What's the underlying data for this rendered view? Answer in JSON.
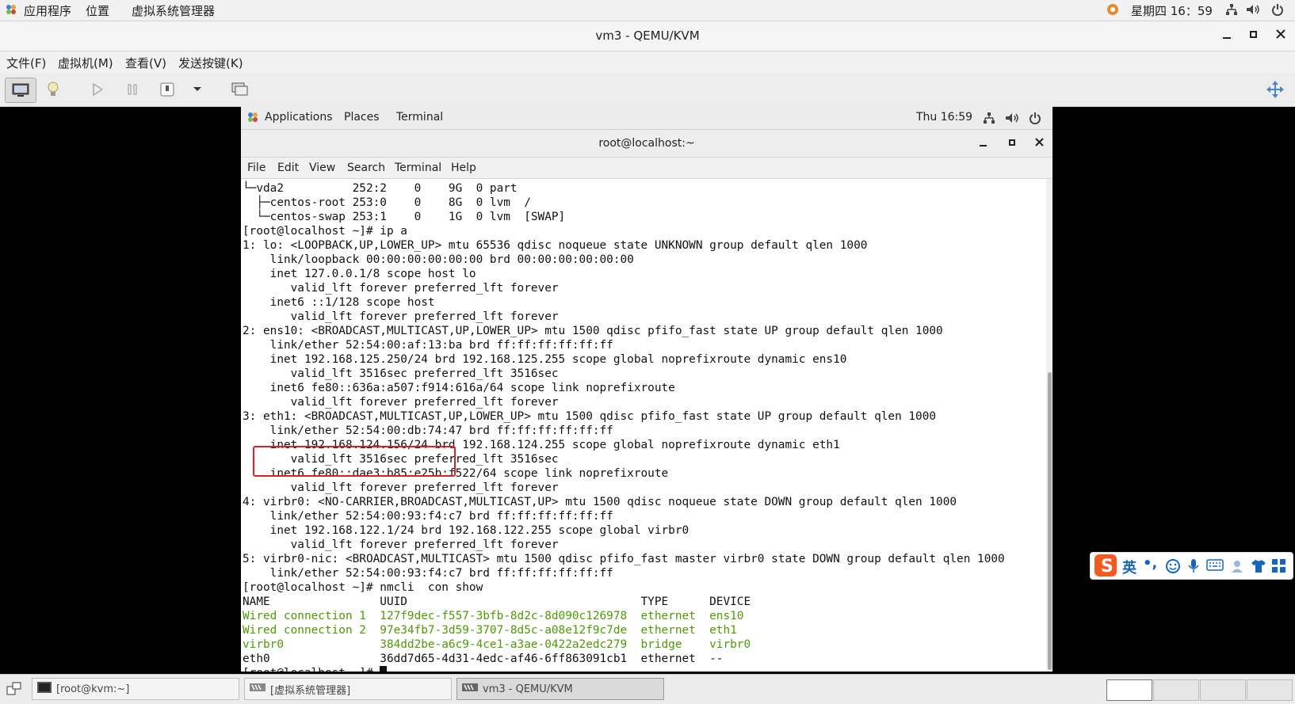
{
  "host_panel": {
    "applications": "应用程序",
    "places": "位置",
    "virt_manager": "虚拟系统管理器",
    "clock": "星期四 16：59"
  },
  "qemu_window": {
    "title": "vm3 - QEMU/KVM",
    "menu": [
      "文件(F)",
      "虚拟机(M)",
      "查看(V)",
      "发送按键(K)"
    ],
    "icons": [
      "monitor-icon",
      "lightbulb-icon",
      "play-icon",
      "pause-icon",
      "power-icon",
      "dropdown-icon",
      "screens-icon",
      "fullscreen-icon"
    ]
  },
  "guest_panel": {
    "applications": "Applications",
    "places": "Places",
    "terminal": "Terminal",
    "clock": "Thu 16:59"
  },
  "terminal_window": {
    "title": "root@localhost:~",
    "menu": [
      "File",
      "Edit",
      "View",
      "Search",
      "Terminal",
      "Help"
    ],
    "lines": [
      "└─vda2          252:2    0    9G  0 part",
      "  ├─centos-root 253:0    0    8G  0 lvm  /",
      "  └─centos-swap 253:1    0    1G  0 lvm  [SWAP]",
      "[root@localhost ~]# ip a",
      "1: lo: <LOOPBACK,UP,LOWER_UP> mtu 65536 qdisc noqueue state UNKNOWN group default qlen 1000",
      "    link/loopback 00:00:00:00:00:00 brd 00:00:00:00:00:00",
      "    inet 127.0.0.1/8 scope host lo",
      "       valid_lft forever preferred_lft forever",
      "    inet6 ::1/128 scope host",
      "       valid_lft forever preferred_lft forever",
      "2: ens10: <BROADCAST,MULTICAST,UP,LOWER_UP> mtu 1500 qdisc pfifo_fast state UP group default qlen 1000",
      "    link/ether 52:54:00:af:13:ba brd ff:ff:ff:ff:ff:ff",
      "    inet 192.168.125.250/24 brd 192.168.125.255 scope global noprefixroute dynamic ens10",
      "       valid_lft 3516sec preferred_lft 3516sec",
      "    inet6 fe80::636a:a507:f914:616a/64 scope link noprefixroute",
      "       valid_lft forever preferred_lft forever",
      "3: eth1: <BROADCAST,MULTICAST,UP,LOWER_UP> mtu 1500 qdisc pfifo_fast state UP group default qlen 1000",
      "    link/ether 52:54:00:db:74:47 brd ff:ff:ff:ff:ff:ff",
      "    inet 192.168.124.156/24 brd 192.168.124.255 scope global noprefixroute dynamic eth1",
      "       valid_lft 3516sec preferred_lft 3516sec",
      "    inet6 fe80::dae3:b85:e25b:f522/64 scope link noprefixroute",
      "       valid_lft forever preferred_lft forever",
      "4: virbr0: <NO-CARRIER,BROADCAST,MULTICAST,UP> mtu 1500 qdisc noqueue state DOWN group default qlen 1000",
      "    link/ether 52:54:00:93:f4:c7 brd ff:ff:ff:ff:ff:ff",
      "    inet 192.168.122.1/24 brd 192.168.122.255 scope global virbr0",
      "       valid_lft forever preferred_lft forever",
      "5: virbr0-nic: <BROADCAST,MULTICAST> mtu 1500 qdisc pfifo_fast master virbr0 state DOWN group default qlen 1000",
      "    link/ether 52:54:00:93:f4:c7 brd ff:ff:ff:ff:ff:ff",
      "[root@localhost ~]# nmcli  con show",
      "NAME                UUID                                  TYPE      DEVICE",
      "Wired connection 1  127f9dec-f557-3bfb-8d2c-8d090c126978  ethernet  ens10",
      "Wired connection 2  97e34fb7-3d59-3707-8d5c-a08e12f9c7de  ethernet  eth1",
      "virbr0              384dd2be-a6c9-4ce1-a3ae-0422a2edc279  bridge    virbr0",
      "eth0                36dd7d65-4d31-4edc-af46-6ff863091cb1  ethernet  --",
      "[root@localhost ~]# "
    ],
    "green_lines": [
      30,
      31,
      32
    ],
    "text_color": "#111111",
    "active_connection_color": "#4e9a06",
    "highlight_color": "#e02020"
  },
  "ime": {
    "lang": "英",
    "punct": "•,"
  },
  "taskbar": {
    "task1": "[root@kvm:~]",
    "task2": "[虚拟系统管理器]",
    "task3": "vm3 - QEMU/KVM"
  }
}
